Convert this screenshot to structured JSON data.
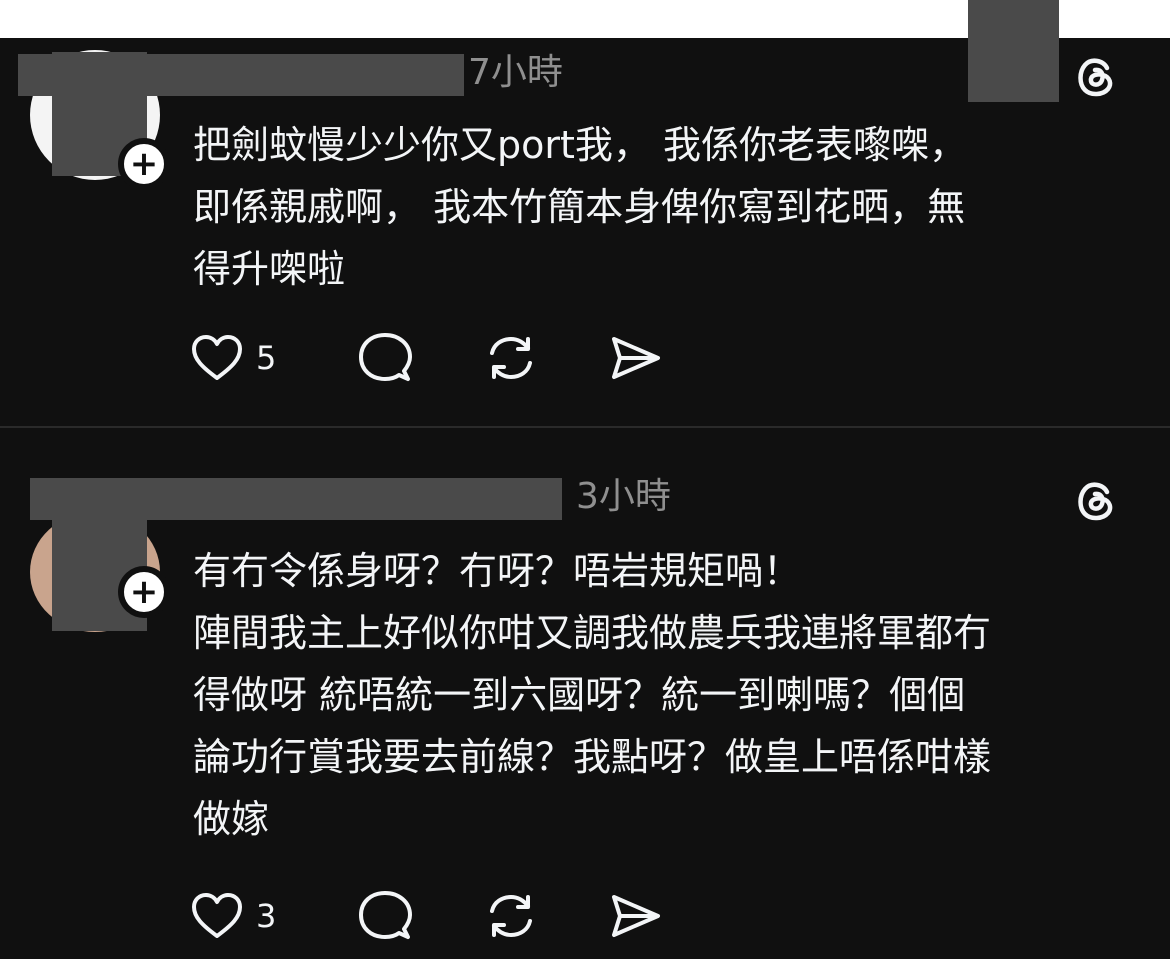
{
  "posts": [
    {
      "timestamp": "7小時",
      "body": "把劍蚊慢少少你又port我， 我係你老表嚟㗎，\n即係親戚啊， 我本竹簡本身俾你寫到花晒，無\n得升㗎啦",
      "like_count": "5",
      "follow_symbol": "+"
    },
    {
      "timestamp": "3小時",
      "body": "有冇令係身呀？冇呀？唔岩規矩喎！\n陣間我主上好似你咁又調我做農兵我連將軍都冇\n得做呀 統唔統一到六國呀？統一到喇嗎？個個\n論功行賞我要去前線？我點呀？做皇上唔係咁樣\n做嫁",
      "like_count": "3",
      "follow_symbol": "+"
    }
  ],
  "icons": {
    "like": "heart-icon",
    "reply": "comment-icon",
    "repost": "repost-icon",
    "share": "send-icon",
    "brand": "threads-icon"
  },
  "colors": {
    "background": "#101010",
    "text": "#f3f5f7",
    "muted": "#8f8f8f",
    "redaction": "#4a4a4a"
  }
}
